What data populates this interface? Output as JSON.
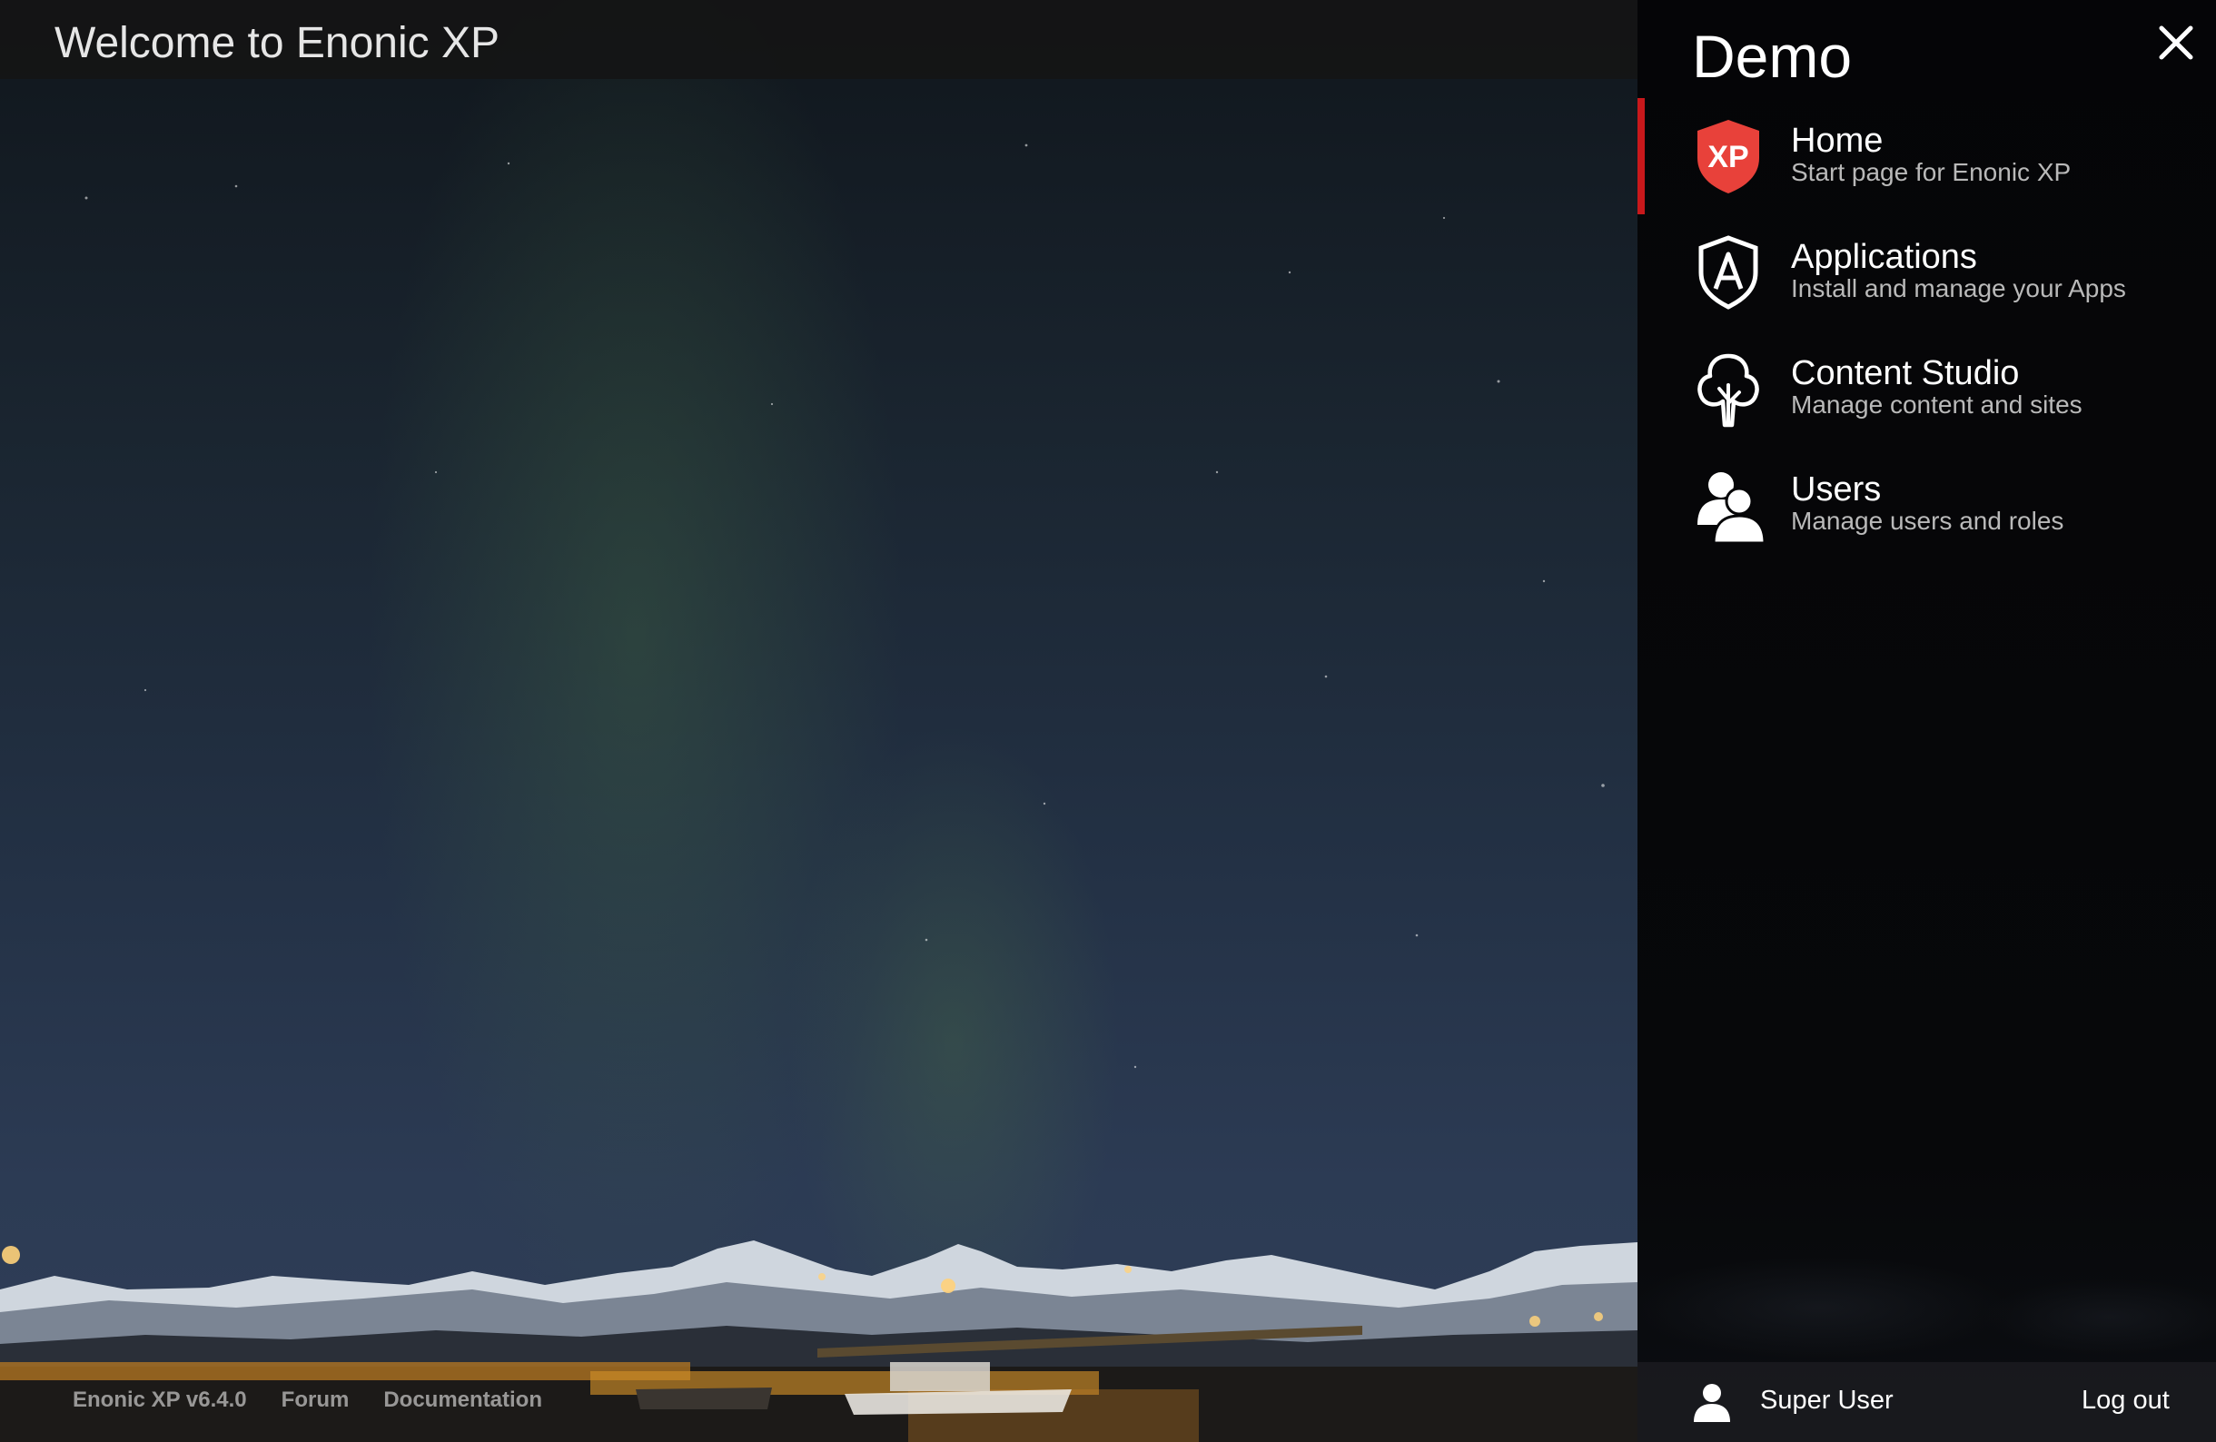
{
  "header": {
    "title": "Welcome to Enonic XP"
  },
  "footer": {
    "version": "Enonic XP v6.4.0",
    "forum": "Forum",
    "documentation": "Documentation"
  },
  "launcher": {
    "title": "Demo",
    "close_icon": "close-icon",
    "accent_color": "#c8181b",
    "apps": [
      {
        "name": "Home",
        "description": "Start page for Enonic XP",
        "icon": "xp-logo-icon",
        "active": true
      },
      {
        "name": "Applications",
        "description": "Install and manage your Apps",
        "icon": "applications-icon",
        "active": false
      },
      {
        "name": "Content Studio",
        "description": "Manage content and sites",
        "icon": "tree-icon",
        "active": false
      },
      {
        "name": "Users",
        "description": "Manage users and roles",
        "icon": "users-icon",
        "active": false
      }
    ],
    "user": {
      "name": "Super User",
      "icon": "user-icon"
    },
    "logout": "Log out"
  }
}
